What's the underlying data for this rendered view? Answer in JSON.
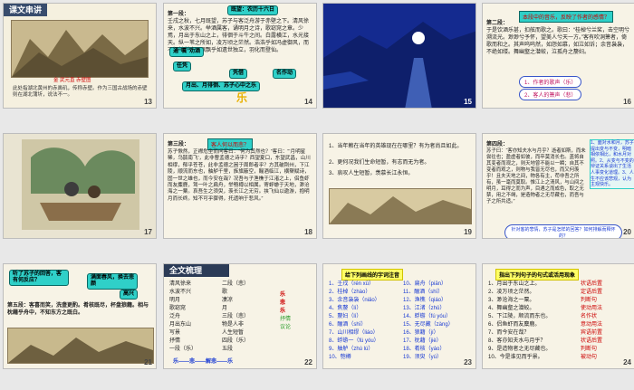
{
  "slides": [
    {
      "num": "13",
      "title": "课文串讲",
      "painting_label": "金 武元直 赤壁图",
      "caption": "此处指湖北黄州的赤鼻矶，传称赤壁。作为三国古战场的赤壁则在湖北蒲圻，说法不一。"
    },
    {
      "num": "14",
      "heading": "第一段：",
      "text": "壬戌之秋，七月既望，苏子与客泛舟游于赤壁之下。清风徐来，水波不兴。举酒属客，诵明月之诗，歌窈窕之章。少焉，月出于东山之上，徘徊于斗牛之间。白露横江，水光接天。纵一苇之所如，凌万顷之茫然。浩浩乎如冯虚御风，而不知其所止；飘飘乎如遗世独立，羽化而登仙。",
      "b1": "既望：农历十六日",
      "b2": "通“嘱”劝酒",
      "b3": "任凭",
      "b4": "凭借",
      "b5": "名作动",
      "b6": "月出、月徘徊、苏子心中之乐",
      "cn": "乐"
    },
    {
      "num": "15"
    },
    {
      "num": "16",
      "heading": "第二段：",
      "note": "本段中的音乐，反映了作者的感情？",
      "text": "于是饮酒乐甚，扣舷而歌之。歌曰：“桂棹兮兰桨，击空明兮溯流光。渺渺兮予怀，望美人兮天一方。”客有吹洞箫者，倚歌而和之。其声呜呜然，如怨如慕，如泣如诉；余音袅袅，不绝如缕。舞幽壑之潜蛟，泣孤舟之嫠妇。",
      "o1": "1、作者的歌声（乐）",
      "o2": "2、客人的箫声（悲）"
    },
    {
      "num": "17"
    },
    {
      "num": "18",
      "heading": "第三段：",
      "q": "客人何以而悲？",
      "text": "苏子愀然，正襟危坐而问客曰：“何为其然也？”客曰：“‘月明星稀，乌鹊南飞’，此非曹孟德之诗乎？西望夏口，东望武昌，山川相缪，郁乎苍苍，此非孟德之困于周郎者乎？方其破荆州，下江陵，顺流而东也，舳舻千里，旌旗蔽空，酾酒临江，横槊赋诗，固一世之雄也，而今安在哉？况吾与子渔樵于江渚之上，侣鱼虾而友麋鹿，驾一叶之扁舟，举匏樽以相属。寄蜉蝣于天地，渺沧海之一粟。哀吾生之须臾，羡长江之无穷。挟飞仙以遨游，抱明月而长终。知不可乎骤得，托遗响于悲风。”"
    },
    {
      "num": "19",
      "l1": "1、当年赖在当年的英雄现在在哪里？有为者尚且如此。",
      "l2": "2、更何况我们生命短暂，有志而无为者。",
      "l3": "3、哀叹人生短暂，羡慕长江永恒。"
    },
    {
      "num": "20",
      "heading": "第四段：",
      "text": "苏子曰：“客亦知夫水与月乎？逝者如斯，而未尝往也；盈虚者如彼，而卒莫消长也。盖将自其变者而观之，则天地曾不能以一瞬；自其不变者而观之，则物与我皆无尽也，而又何羡乎！且夫天地之间，物各有主，苟非吾之所有，虽一毫而莫取。惟江上之清风，与山间之明月，耳得之而为声，目遇之而成色，取之无禁，用之不竭，是造物者之无尽藏也，而吾与子之所共适。”",
      "bottom": "针对客的悲情，苏子是怎样的回答？如何排解而释怀的？",
      "side": "1、面对水和月，苏子提出变与不变，明暗相依相比，和水月对照。2、从变与不变的辩证关系谈出了生活人事变化道理。3、人生不应该悲观，认为主观快乐。"
    },
    {
      "num": "21",
      "bubble": "听了苏子的回答，客有何反应？",
      "b2": "满面春风，换去悲颜",
      "b3": "高兴",
      "text": "第五段：客喜而笑，洗盏更酌。肴核既尽，杯盘狼籍。相与枕藉乎舟中，不知东方之既白。"
    },
    {
      "num": "22",
      "title": "全文梳理",
      "col_left": [
        "清风徐来",
        "水波不兴",
        "明月",
        "歌窈窕",
        "泛舟",
        "月出东山",
        "写景",
        "抒情",
        "一段（乐）"
      ],
      "col_mid": [
        "二段（悲）",
        "歌",
        "凄凉",
        "月",
        "三段（悲）",
        "物是人非",
        "人生短暂",
        "四段（乐）",
        "五段"
      ],
      "col_right": [
        "乐",
        "悲",
        "乐",
        "抒情",
        "议论"
      ],
      "footer": "乐——悲——解悲——乐"
    },
    {
      "num": "23",
      "head": "给下列画线的字词注音",
      "left": [
        "1、壬戌（rén xū）",
        "2、桂棹（zhào）",
        "3、余音袅袅（niǎo）",
        "4、焦嫠（lí）",
        "5、嫠妇（lí）",
        "6、酾酒（shī）",
        "7、山川相缪（liáo）",
        "8、蜉蝣一（fú yóu）",
        "9、舳舻（zhú lú）",
        "10、匏樽"
      ],
      "right": [
        "10、扁舟（piān）",
        "11、酾酒（shī）",
        "12、渔樵（qiáo）",
        "13、江渚（zhǔ）",
        "14、蜉蝣（fú yóu）",
        "15、无尽藏（zàng）",
        "16、狼籍（jí）",
        "17、枕藉（jiè）",
        "18、肴核（yáo）",
        "19、须臾（yú）"
      ]
    },
    {
      "num": "24",
      "head": "指出下列句子的句式或活用现象",
      "items": [
        "1、月出于东山之上。",
        "2、凌万顷之茫然。",
        "3、渺沧海之一粟。",
        "4、舞幽壑之潜蛟。",
        "5、下江陵，顺流而东也。",
        "6、侣鱼虾而友麋鹿。",
        "7、而今安在哉？",
        "8、客亦知夫水与月乎？",
        "9、是造物者之无尽藏也。",
        "10、今是谁见而乎景。"
      ],
      "tags": [
        "状语后置",
        "定语后置",
        "判断句",
        "使动用法",
        "名作状",
        "意动用法",
        "宾语前置",
        "状语后置",
        "判断句",
        "被动句"
      ]
    }
  ]
}
